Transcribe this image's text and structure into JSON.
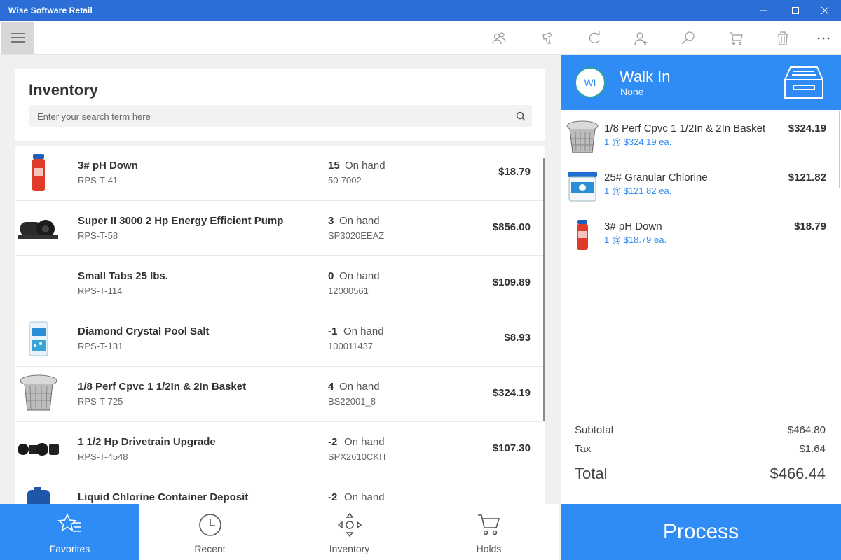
{
  "window": {
    "title": "Wise Software Retail"
  },
  "toolbar": {
    "icons": [
      "customers-icon",
      "hand-icon",
      "refresh-icon",
      "add-customer-icon",
      "search-icon",
      "cart-icon",
      "trash-icon",
      "more-icon"
    ]
  },
  "inventory": {
    "title": "Inventory",
    "search_placeholder": "Enter your search term here",
    "onhand_label": "On hand",
    "items": [
      {
        "name": "3# pH Down",
        "sku": "RPS-T-41",
        "qty": "15",
        "code": "50-7002",
        "price": "$18.79"
      },
      {
        "name": "Super II  3000 2 Hp Energy Efficient Pump",
        "sku": "RPS-T-58",
        "qty": "3",
        "code": "SP3020EEAZ",
        "price": "$856.00"
      },
      {
        "name": "Small Tabs 25 lbs.",
        "sku": "RPS-T-114",
        "qty": "0",
        "code": "12000561",
        "price": "$109.89"
      },
      {
        "name": "Diamond Crystal Pool Salt",
        "sku": "RPS-T-131",
        "qty": "-1",
        "code": "100011437",
        "price": "$8.93"
      },
      {
        "name": "1/8 Perf Cpvc 1 1/2In & 2In Basket",
        "sku": "RPS-T-725",
        "qty": "4",
        "code": "BS22001_8",
        "price": "$324.19"
      },
      {
        "name": "1 1/2 Hp Drivetrain Upgrade",
        "sku": "RPS-T-4548",
        "qty": "-2",
        "code": "SPX2610CKIT",
        "price": "$107.30"
      },
      {
        "name": "Liquid Chlorine Container Deposit",
        "sku": "",
        "qty": "-2",
        "code": "",
        "price": ""
      }
    ]
  },
  "nav": {
    "favorites": "Favorites",
    "recent": "Recent",
    "inventory": "Inventory",
    "holds": "Holds"
  },
  "customer": {
    "initials": "WI",
    "name": "Walk In",
    "sub": "None"
  },
  "cart": [
    {
      "name": "1/8 Perf Cpvc 1 1/2In & 2In Basket",
      "detail": "1 @ $324.19 ea.",
      "price": "$324.19"
    },
    {
      "name": "25# Granular Chlorine",
      "detail": "1 @ $121.82 ea.",
      "price": "$121.82"
    },
    {
      "name": "3# pH Down",
      "detail": "1 @ $18.79 ea.",
      "price": "$18.79"
    }
  ],
  "totals": {
    "subtotal_label": "Subtotal",
    "subtotal": "$464.80",
    "tax_label": "Tax",
    "tax": "$1.64",
    "total_label": "Total",
    "total": "$466.44"
  },
  "process_label": "Process",
  "colors": {
    "accent": "#2f8cf4",
    "titlebar": "#2b6fd6"
  }
}
